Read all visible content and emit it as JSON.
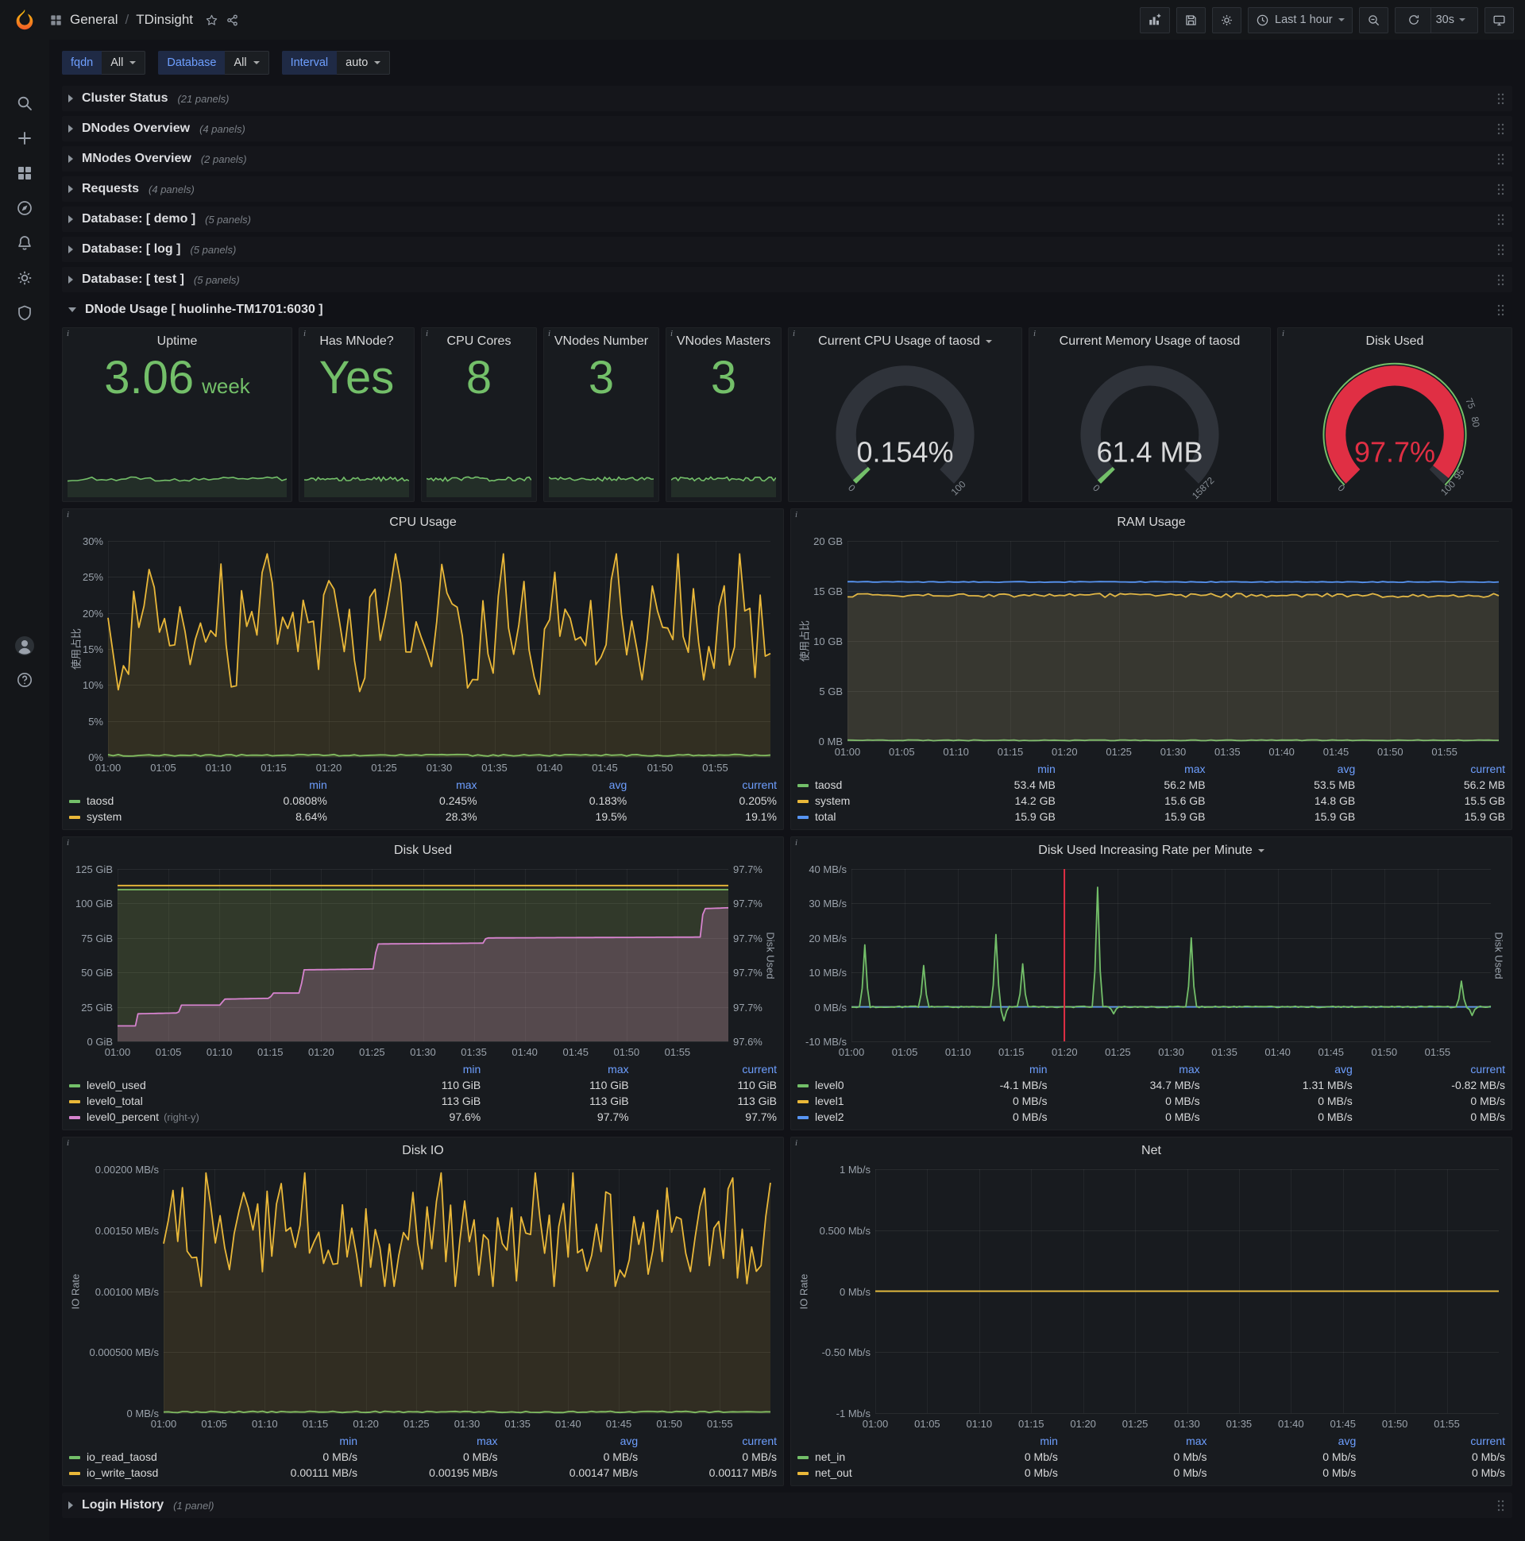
{
  "app": {
    "breadcrumb": {
      "folder": "General",
      "separator": "/",
      "title": "TDinsight"
    },
    "toolbar": {
      "time_range": "Last 1 hour",
      "refresh_interval": "30s"
    },
    "variables": [
      {
        "label": "fqdn",
        "value": "All"
      },
      {
        "label": "Database",
        "value": "All"
      },
      {
        "label": "Interval",
        "value": "auto"
      }
    ]
  },
  "misc": {
    "panel_info_glyph": "i"
  },
  "rows_top": [
    {
      "title": "Cluster Status",
      "count": "(21 panels)"
    },
    {
      "title": "DNodes Overview",
      "count": "(4 panels)"
    },
    {
      "title": "MNodes Overview",
      "count": "(2 panels)"
    },
    {
      "title": "Requests",
      "count": "(4 panels)"
    },
    {
      "title": "Database: [ demo ]",
      "count": "(5 panels)"
    },
    {
      "title": "Database: [ log ]",
      "count": "(5 panels)"
    },
    {
      "title": "Database: [ test ]",
      "count": "(5 panels)"
    }
  ],
  "expanded_row": {
    "title": "DNode Usage [ huolinhe-TM1701:6030 ]"
  },
  "rows_bottom": [
    {
      "title": "Login History",
      "count": "(1 panel)"
    }
  ],
  "stat_panels": [
    {
      "title": "Uptime",
      "value": "3.06",
      "unit": "week"
    },
    {
      "title": "Has MNode?",
      "value": "Yes",
      "unit": ""
    },
    {
      "title": "CPU Cores",
      "value": "8",
      "unit": ""
    },
    {
      "title": "VNodes Number",
      "value": "3",
      "unit": ""
    },
    {
      "title": "VNodes Masters",
      "value": "3",
      "unit": ""
    }
  ],
  "gauge_panels": [
    {
      "title": "Current CPU Usage of taosd",
      "menu": true,
      "value": "0.154%",
      "fraction": 0.00154,
      "arc_color": "#73bf69",
      "value_color": "#d8d9da",
      "min_label": "0",
      "max_label": "100",
      "thresholds": [],
      "outline": null
    },
    {
      "title": "Current Memory Usage of taosd",
      "menu": false,
      "value": "61.4 MB",
      "fraction": 0.0039,
      "arc_color": "#73bf69",
      "value_color": "#d8d9da",
      "min_label": "0",
      "max_label": "15872",
      "thresholds": [],
      "outline": null
    },
    {
      "title": "Disk Used",
      "menu": false,
      "value": "97.7%",
      "fraction": 0.977,
      "arc_color": "#e02f44",
      "value_color": "#e02f44",
      "min_label": "0",
      "max_label": "100",
      "thresholds": [
        {
          "text": "75",
          "f": 0.75
        },
        {
          "text": "80",
          "f": 0.8
        },
        {
          "text": "95",
          "f": 0.95
        }
      ],
      "outline": "#73bf69"
    }
  ],
  "chart_data": [
    {
      "type": "line",
      "title": "CPU Usage",
      "menu": false,
      "ylabel": "使用占比",
      "ylabel_right": null,
      "ylim": [
        0,
        30
      ],
      "unit": "%",
      "y_ticks": [
        "30%",
        "25%",
        "20%",
        "15%",
        "10%",
        "5%",
        "0%"
      ],
      "y_ticks_right": null,
      "x_ticks": [
        "01:00",
        "01:05",
        "01:10",
        "01:15",
        "01:20",
        "01:25",
        "01:30",
        "01:35",
        "01:40",
        "01:45",
        "01:50",
        "01:55"
      ],
      "x_range": [
        "01:00",
        "02:00"
      ],
      "legend_cols": [
        "min",
        "max",
        "avg",
        "current"
      ],
      "series": [
        {
          "name": "taosd",
          "color": "#73bf69",
          "fill": 0.15,
          "legend": [
            "0.0808%",
            "0.245%",
            "0.183%",
            "0.205%"
          ],
          "wave": {
            "kind": "flat",
            "level": 0.008,
            "noise": 0.004,
            "seed": 21
          }
        },
        {
          "name": "system",
          "color": "#eab839",
          "fill": 0.13,
          "legend": [
            "8.64%",
            "28.3%",
            "19.5%",
            "19.1%"
          ],
          "wave": {
            "kind": "noise",
            "base": 0.62,
            "amp": 0.3,
            "min": 0.29,
            "max": 0.94,
            "freq": 0.55,
            "seed": 7
          }
        }
      ],
      "annotation_x": null
    },
    {
      "type": "line",
      "title": "RAM Usage",
      "menu": false,
      "ylabel": "使用占比",
      "ylabel_right": null,
      "ylim": [
        0,
        20
      ],
      "unit": "GB",
      "y_ticks": [
        "20 GB",
        "15 GB",
        "10 GB",
        "5 GB",
        "0 MB"
      ],
      "y_ticks_right": null,
      "x_ticks": [
        "01:00",
        "01:05",
        "01:10",
        "01:15",
        "01:20",
        "01:25",
        "01:30",
        "01:35",
        "01:40",
        "01:45",
        "01:50",
        "01:55"
      ],
      "x_range": [
        "01:00",
        "02:00"
      ],
      "legend_cols": [
        "min",
        "max",
        "avg",
        "current"
      ],
      "series": [
        {
          "name": "taosd",
          "color": "#73bf69",
          "fill": 0.15,
          "legend": [
            "53.4 MB",
            "56.2 MB",
            "53.5 MB",
            "56.2 MB"
          ],
          "wave": {
            "kind": "flat",
            "level": 0.004,
            "noise": 0.002,
            "seed": 5
          }
        },
        {
          "name": "system",
          "color": "#eab839",
          "fill": 0.14,
          "legend": [
            "14.2 GB",
            "15.6 GB",
            "14.8 GB",
            "15.5 GB"
          ],
          "wave": {
            "kind": "flat",
            "level": 0.728,
            "noise": 0.01,
            "seed": 6
          }
        },
        {
          "name": "total",
          "color": "#5794f2",
          "fill": 0.07,
          "legend": [
            "15.9 GB",
            "15.9 GB",
            "15.9 GB",
            "15.9 GB"
          ],
          "wave": {
            "kind": "flat",
            "level": 0.795,
            "noise": 0.002,
            "seed": 8
          }
        }
      ],
      "annotation_x": null
    },
    {
      "type": "line",
      "title": "Disk Used",
      "menu": false,
      "ylabel": null,
      "ylabel_right": "Disk Used",
      "ylim": [
        0,
        125
      ],
      "ylim_right": [
        97.6,
        97.7
      ],
      "unit": "GiB",
      "y_ticks": [
        "125 GiB",
        "100 GiB",
        "75 GiB",
        "50 GiB",
        "25 GiB",
        "0 GiB"
      ],
      "y_ticks_right": [
        "97.7%",
        "97.7%",
        "97.7%",
        "97.7%",
        "97.7%",
        "97.6%"
      ],
      "x_ticks": [
        "01:00",
        "01:05",
        "01:10",
        "01:15",
        "01:20",
        "01:25",
        "01:30",
        "01:35",
        "01:40",
        "01:45",
        "01:50",
        "01:55"
      ],
      "x_range": [
        "01:00",
        "02:00"
      ],
      "legend_cols": [
        "min",
        "max",
        "current"
      ],
      "series": [
        {
          "name": "level0_used",
          "color": "#73bf69",
          "fill": 0.13,
          "legend": [
            "110 GiB",
            "110 GiB",
            "110 GiB"
          ],
          "wave": {
            "kind": "flat",
            "level": 0.88,
            "noise": 0,
            "seed": 1
          }
        },
        {
          "name": "level0_total",
          "color": "#eab839",
          "fill": 0.07,
          "legend": [
            "113 GiB",
            "113 GiB",
            "113 GiB"
          ],
          "wave": {
            "kind": "flat",
            "level": 0.904,
            "noise": 0,
            "seed": 1
          }
        },
        {
          "name": "level0_percent",
          "suffix": "(right-y)",
          "color": "#d683ce",
          "fill": 0.22,
          "legend": [
            "97.6%",
            "97.7%",
            "97.7%"
          ],
          "wave": {
            "kind": "pts",
            "pts": [
              [
                0,
                0.09
              ],
              [
                0.03,
                0.09
              ],
              [
                0.033,
                0.16
              ],
              [
                0.1,
                0.165
              ],
              [
                0.103,
                0.21
              ],
              [
                0.17,
                0.21
              ],
              [
                0.173,
                0.245
              ],
              [
                0.25,
                0.25
              ],
              [
                0.253,
                0.28
              ],
              [
                0.3,
                0.28
              ],
              [
                0.303,
                0.415
              ],
              [
                0.42,
                0.42
              ],
              [
                0.424,
                0.565
              ],
              [
                0.6,
                0.57
              ],
              [
                0.603,
                0.6
              ],
              [
                0.955,
                0.605
              ],
              [
                0.959,
                0.77
              ],
              [
                1,
                0.775
              ]
            ]
          }
        }
      ],
      "annotation_x": null
    },
    {
      "type": "line",
      "title": "Disk Used Increasing Rate per Minute",
      "menu": true,
      "ylabel": null,
      "ylabel_right": "Disk Used",
      "ylim": [
        -10,
        40
      ],
      "unit": "MB/s",
      "y_ticks": [
        "40 MB/s",
        "30 MB/s",
        "20 MB/s",
        "10 MB/s",
        "0 MB/s",
        "-10 MB/s"
      ],
      "y_ticks_right": null,
      "x_ticks": [
        "01:00",
        "01:05",
        "01:10",
        "01:15",
        "01:20",
        "01:25",
        "01:30",
        "01:35",
        "01:40",
        "01:45",
        "01:50",
        "01:55"
      ],
      "x_range": [
        "01:00",
        "02:00"
      ],
      "legend_cols": [
        "min",
        "max",
        "avg",
        "current"
      ],
      "series": [
        {
          "name": "level0",
          "color": "#73bf69",
          "fill": 0.1,
          "fill_base": 0.2,
          "z": 10,
          "legend": [
            "-4.1 MB/s",
            "34.7 MB/s",
            "1.31 MB/s",
            "-0.82 MB/s"
          ],
          "wave": {
            "kind": "spikes",
            "base": 0.2,
            "seed": 9,
            "spikes": [
              [
                0.02,
                0.56
              ],
              [
                0.115,
                0.44
              ],
              [
                0.225,
                0.62
              ],
              [
                0.268,
                0.45
              ],
              [
                0.383,
                0.894
              ],
              [
                0.53,
                0.6
              ],
              [
                0.955,
                0.35
              ]
            ],
            "dips": [
              [
                0.24,
                0.12
              ],
              [
                0.41,
                0.16
              ],
              [
                0.97,
                0.15
              ]
            ]
          }
        },
        {
          "name": "level1",
          "color": "#eab839",
          "fill": 0,
          "legend": [
            "0 MB/s",
            "0 MB/s",
            "0 MB/s",
            "0 MB/s"
          ],
          "wave": {
            "kind": "flat",
            "level": 0.2,
            "noise": 0,
            "seed": 1
          }
        },
        {
          "name": "level2",
          "color": "#5794f2",
          "fill": 0,
          "legend": [
            "0 MB/s",
            "0 MB/s",
            "0 MB/s",
            "0 MB/s"
          ],
          "wave": {
            "kind": "flat",
            "level": 0.2,
            "noise": 0,
            "seed": 1
          }
        }
      ],
      "annotation_x": 0.333
    },
    {
      "type": "line",
      "title": "Disk IO",
      "menu": false,
      "ylabel": "IO Rate",
      "ylabel_right": null,
      "ylim": [
        0,
        0.002
      ],
      "unit": "MB/s",
      "y_ticks": [
        "0.00200 MB/s",
        "0.00150 MB/s",
        "0.00100 MB/s",
        "0.000500 MB/s",
        "0 MB/s"
      ],
      "y_ticks_right": null,
      "x_ticks": [
        "01:00",
        "01:05",
        "01:10",
        "01:15",
        "01:20",
        "01:25",
        "01:30",
        "01:35",
        "01:40",
        "01:45",
        "01:50",
        "01:55"
      ],
      "x_range": [
        "01:00",
        "02:00"
      ],
      "legend_cols": [
        "min",
        "max",
        "avg",
        "current"
      ],
      "series": [
        {
          "name": "io_read_taosd",
          "color": "#73bf69",
          "fill": 0.1,
          "legend": [
            "0 MB/s",
            "0 MB/s",
            "0 MB/s",
            "0 MB/s"
          ],
          "wave": {
            "kind": "flat",
            "level": 0.005,
            "noise": 0.003,
            "seed": 12
          }
        },
        {
          "name": "io_write_taosd",
          "color": "#eab839",
          "fill": 0.12,
          "legend": [
            "0.00111 MB/s",
            "0.00195 MB/s",
            "0.00147 MB/s",
            "0.00117 MB/s"
          ],
          "wave": {
            "kind": "noise",
            "base": 0.72,
            "amp": 0.22,
            "min": 0.52,
            "max": 0.985,
            "freq": 0.9,
            "seed": 13
          }
        }
      ],
      "annotation_x": null
    },
    {
      "type": "line",
      "title": "Net",
      "menu": false,
      "ylabel": "IO Rate",
      "ylabel_right": null,
      "ylim": [
        -1,
        1
      ],
      "unit": "Mb/s",
      "y_ticks": [
        "1 Mb/s",
        "0.500 Mb/s",
        "0 Mb/s",
        "-0.50 Mb/s",
        "-1 Mb/s"
      ],
      "y_ticks_right": null,
      "x_ticks": [
        "01:00",
        "01:05",
        "01:10",
        "01:15",
        "01:20",
        "01:25",
        "01:30",
        "01:35",
        "01:40",
        "01:45",
        "01:50",
        "01:55"
      ],
      "x_range": [
        "01:00",
        "02:00"
      ],
      "legend_cols": [
        "min",
        "max",
        "avg",
        "current"
      ],
      "series": [
        {
          "name": "net_in",
          "color": "#73bf69",
          "fill": 0,
          "legend": [
            "0 Mb/s",
            "0 Mb/s",
            "0 Mb/s",
            "0 Mb/s"
          ],
          "wave": {
            "kind": "flat",
            "level": 0.5,
            "noise": 0,
            "seed": 1
          }
        },
        {
          "name": "net_out",
          "color": "#eab839",
          "fill": 0,
          "z": 10,
          "legend": [
            "0 Mb/s",
            "0 Mb/s",
            "0 Mb/s",
            "0 Mb/s"
          ],
          "wave": {
            "kind": "flat",
            "level": 0.5,
            "noise": 0,
            "seed": 1
          }
        }
      ],
      "annotation_x": null
    }
  ],
  "colors": {
    "green": "#73bf69",
    "yellow": "#eab839",
    "blue": "#5794f2",
    "pink": "#d683ce",
    "red": "#e02f44",
    "legend_header": "#6e9fff",
    "panel_bg": "#181b1f",
    "page_bg": "#111217"
  }
}
